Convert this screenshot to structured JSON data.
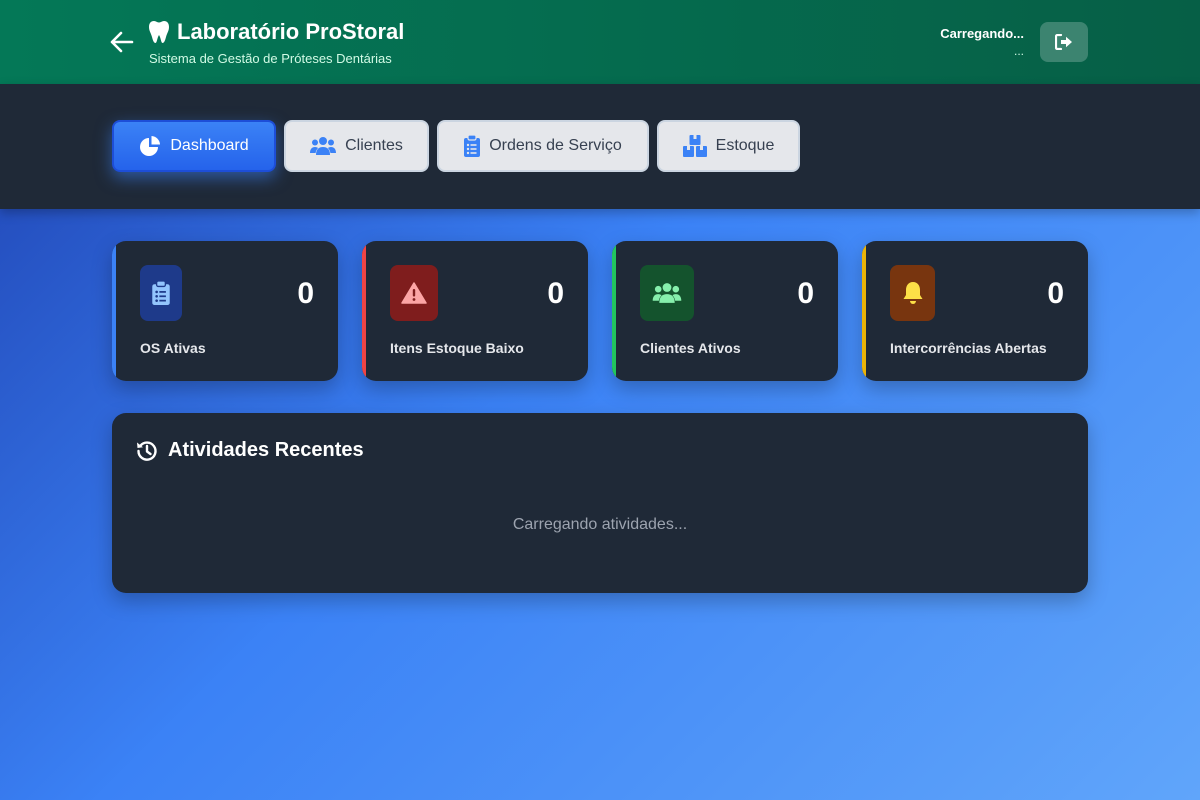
{
  "header": {
    "title": "Laboratório ProStoral",
    "subtitle": "Sistema de Gestão de Próteses Dentárias",
    "user_name": "Carregando...",
    "user_role": "...",
    "back_icon": "arrow-left-icon",
    "brand_icon": "tooth-icon",
    "logout_icon": "sign-out-icon"
  },
  "nav": {
    "tabs": [
      {
        "label": "Dashboard",
        "icon": "chart-pie-icon",
        "active": true
      },
      {
        "label": "Clientes",
        "icon": "users-icon",
        "active": false
      },
      {
        "label": "Ordens de Serviço",
        "icon": "clipboard-list-icon",
        "active": false
      },
      {
        "label": "Estoque",
        "icon": "boxes-icon",
        "active": false
      }
    ]
  },
  "stats": [
    {
      "label": "OS Ativas",
      "value": "0",
      "icon": "clipboard-list-icon",
      "accent": "#3b82f6",
      "icon_bg": "#1e3a8a",
      "icon_color": "#93c5fd"
    },
    {
      "label": "Itens Estoque Baixo",
      "value": "0",
      "icon": "warning-triangle-icon",
      "accent": "#ef4444",
      "icon_bg": "#7f1d1d",
      "icon_color": "#fca5a5"
    },
    {
      "label": "Clientes Ativos",
      "value": "0",
      "icon": "users-icon",
      "accent": "#22c55e",
      "icon_bg": "#14532d",
      "icon_color": "#86efac"
    },
    {
      "label": "Intercorrências Abertas",
      "value": "0",
      "icon": "bell-icon",
      "accent": "#eab308",
      "icon_bg": "#78350f",
      "icon_color": "#fde047"
    }
  ],
  "activity": {
    "title": "Atividades Recentes",
    "icon": "history-icon",
    "empty_text": "Carregando atividades..."
  },
  "colors": {
    "header_green": "#047857",
    "nav_dark": "#1f2937",
    "active_tab_blue": "#2563eb",
    "card_dark": "#1f2937"
  }
}
